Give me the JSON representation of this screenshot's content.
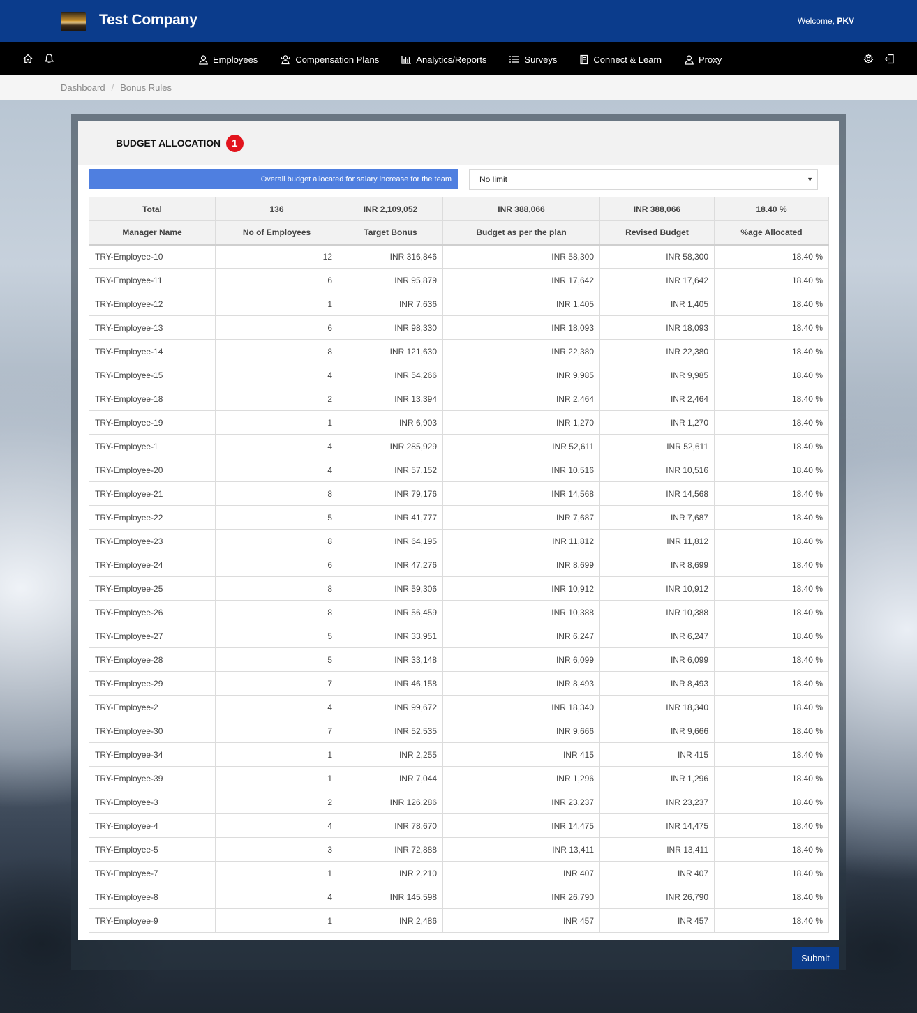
{
  "header": {
    "company_name": "Test Company",
    "welcome_prefix": "Welcome, ",
    "user": "PKV"
  },
  "nav": {
    "notification_count": "0",
    "items": [
      {
        "label": "Employees",
        "icon": "user-icon"
      },
      {
        "label": "Compensation Plans",
        "icon": "users-icon"
      },
      {
        "label": "Analytics/Reports",
        "icon": "bar-chart-icon"
      },
      {
        "label": "Surveys",
        "icon": "list-icon"
      },
      {
        "label": "Connect & Learn",
        "icon": "book-icon"
      },
      {
        "label": "Proxy",
        "icon": "user-icon"
      }
    ]
  },
  "breadcrumb": {
    "items": [
      "Dashboard",
      "Bonus Rules"
    ],
    "separator": "/"
  },
  "card": {
    "title": "BUDGET ALLOCATION",
    "step": "1",
    "budget_label": "Overall budget allocated for salary increase for the team",
    "budget_select_value": "No limit"
  },
  "table": {
    "totals": [
      "Total",
      "136",
      "INR 2,109,052",
      "INR 388,066",
      "INR 388,066",
      "18.40 %"
    ],
    "headers": [
      "Manager Name",
      "No of Employees",
      "Target Bonus",
      "Budget as per the plan",
      "Revised Budget",
      "%age Allocated"
    ],
    "rows": [
      [
        "TRY-Employee-10",
        "12",
        "INR 316,846",
        "INR 58,300",
        "INR 58,300",
        "18.40 %"
      ],
      [
        "TRY-Employee-11",
        "6",
        "INR 95,879",
        "INR 17,642",
        "INR 17,642",
        "18.40 %"
      ],
      [
        "TRY-Employee-12",
        "1",
        "INR 7,636",
        "INR 1,405",
        "INR 1,405",
        "18.40 %"
      ],
      [
        "TRY-Employee-13",
        "6",
        "INR 98,330",
        "INR 18,093",
        "INR 18,093",
        "18.40 %"
      ],
      [
        "TRY-Employee-14",
        "8",
        "INR 121,630",
        "INR 22,380",
        "INR 22,380",
        "18.40 %"
      ],
      [
        "TRY-Employee-15",
        "4",
        "INR 54,266",
        "INR 9,985",
        "INR 9,985",
        "18.40 %"
      ],
      [
        "TRY-Employee-18",
        "2",
        "INR 13,394",
        "INR 2,464",
        "INR 2,464",
        "18.40 %"
      ],
      [
        "TRY-Employee-19",
        "1",
        "INR 6,903",
        "INR 1,270",
        "INR 1,270",
        "18.40 %"
      ],
      [
        "TRY-Employee-1",
        "4",
        "INR 285,929",
        "INR 52,611",
        "INR 52,611",
        "18.40 %"
      ],
      [
        "TRY-Employee-20",
        "4",
        "INR 57,152",
        "INR 10,516",
        "INR 10,516",
        "18.40 %"
      ],
      [
        "TRY-Employee-21",
        "8",
        "INR 79,176",
        "INR 14,568",
        "INR 14,568",
        "18.40 %"
      ],
      [
        "TRY-Employee-22",
        "5",
        "INR 41,777",
        "INR 7,687",
        "INR 7,687",
        "18.40 %"
      ],
      [
        "TRY-Employee-23",
        "8",
        "INR 64,195",
        "INR 11,812",
        "INR 11,812",
        "18.40 %"
      ],
      [
        "TRY-Employee-24",
        "6",
        "INR 47,276",
        "INR 8,699",
        "INR 8,699",
        "18.40 %"
      ],
      [
        "TRY-Employee-25",
        "8",
        "INR 59,306",
        "INR 10,912",
        "INR 10,912",
        "18.40 %"
      ],
      [
        "TRY-Employee-26",
        "8",
        "INR 56,459",
        "INR 10,388",
        "INR 10,388",
        "18.40 %"
      ],
      [
        "TRY-Employee-27",
        "5",
        "INR 33,951",
        "INR 6,247",
        "INR 6,247",
        "18.40 %"
      ],
      [
        "TRY-Employee-28",
        "5",
        "INR 33,148",
        "INR 6,099",
        "INR 6,099",
        "18.40 %"
      ],
      [
        "TRY-Employee-29",
        "7",
        "INR 46,158",
        "INR 8,493",
        "INR 8,493",
        "18.40 %"
      ],
      [
        "TRY-Employee-2",
        "4",
        "INR 99,672",
        "INR 18,340",
        "INR 18,340",
        "18.40 %"
      ],
      [
        "TRY-Employee-30",
        "7",
        "INR 52,535",
        "INR 9,666",
        "INR 9,666",
        "18.40 %"
      ],
      [
        "TRY-Employee-34",
        "1",
        "INR 2,255",
        "INR 415",
        "INR 415",
        "18.40 %"
      ],
      [
        "TRY-Employee-39",
        "1",
        "INR 7,044",
        "INR 1,296",
        "INR 1,296",
        "18.40 %"
      ],
      [
        "TRY-Employee-3",
        "2",
        "INR 126,286",
        "INR 23,237",
        "INR 23,237",
        "18.40 %"
      ],
      [
        "TRY-Employee-4",
        "4",
        "INR 78,670",
        "INR 14,475",
        "INR 14,475",
        "18.40 %"
      ],
      [
        "TRY-Employee-5",
        "3",
        "INR 72,888",
        "INR 13,411",
        "INR 13,411",
        "18.40 %"
      ],
      [
        "TRY-Employee-7",
        "1",
        "INR 2,210",
        "INR 407",
        "INR 407",
        "18.40 %"
      ],
      [
        "TRY-Employee-8",
        "4",
        "INR 145,598",
        "INR 26,790",
        "INR 26,790",
        "18.40 %"
      ],
      [
        "TRY-Employee-9",
        "1",
        "INR 2,486",
        "INR 457",
        "INR 457",
        "18.40 %"
      ]
    ]
  },
  "actions": {
    "submit_label": "Submit"
  },
  "colors": {
    "header_bg": "#0b3c8c",
    "nav_bg": "#000000",
    "budget_label_bg": "#4f7fe0",
    "step_badge": "#e2141d",
    "notification_badge": "#14b89a"
  }
}
